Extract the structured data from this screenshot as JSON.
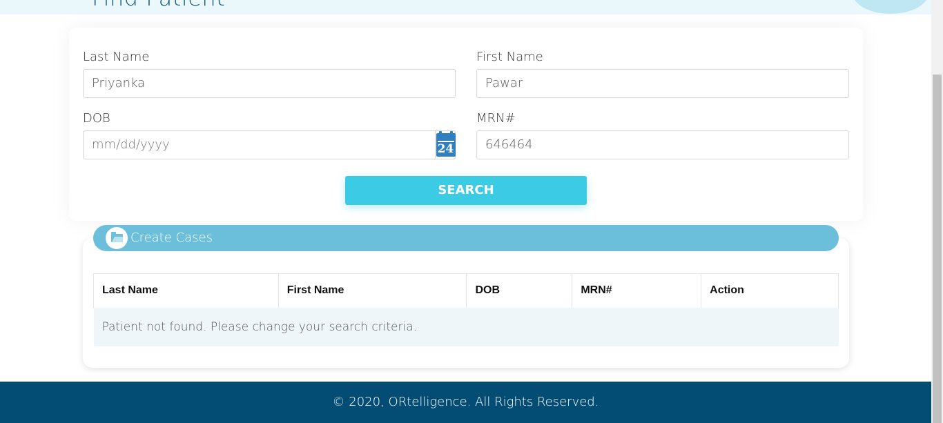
{
  "header": {
    "page_title": "Find Patient"
  },
  "search_form": {
    "last_name": {
      "label": "Last Name",
      "value": "Priyanka"
    },
    "first_name": {
      "label": "First Name",
      "value": "Pawar"
    },
    "dob": {
      "label": "DOB",
      "placeholder": "mm/dd/yyyy",
      "calendar_icon_text": "24"
    },
    "mrn": {
      "label": "MRN#",
      "value": "646464"
    },
    "search_button": "SEARCH"
  },
  "cases": {
    "title": "Create Cases",
    "icon": "folder-open-icon",
    "columns": [
      "Last Name",
      "First Name",
      "DOB",
      "MRN#",
      "Action"
    ],
    "empty_message": "Patient not found. Please change your search criteria."
  },
  "footer": {
    "text": "© 2020, ORtelligence. All Rights Reserved."
  },
  "colors": {
    "accent": "#3ccbe4",
    "header_bar": "#6cbfdb",
    "footer_bg": "#034d74",
    "calendar_icon": "#2f7fc1"
  }
}
